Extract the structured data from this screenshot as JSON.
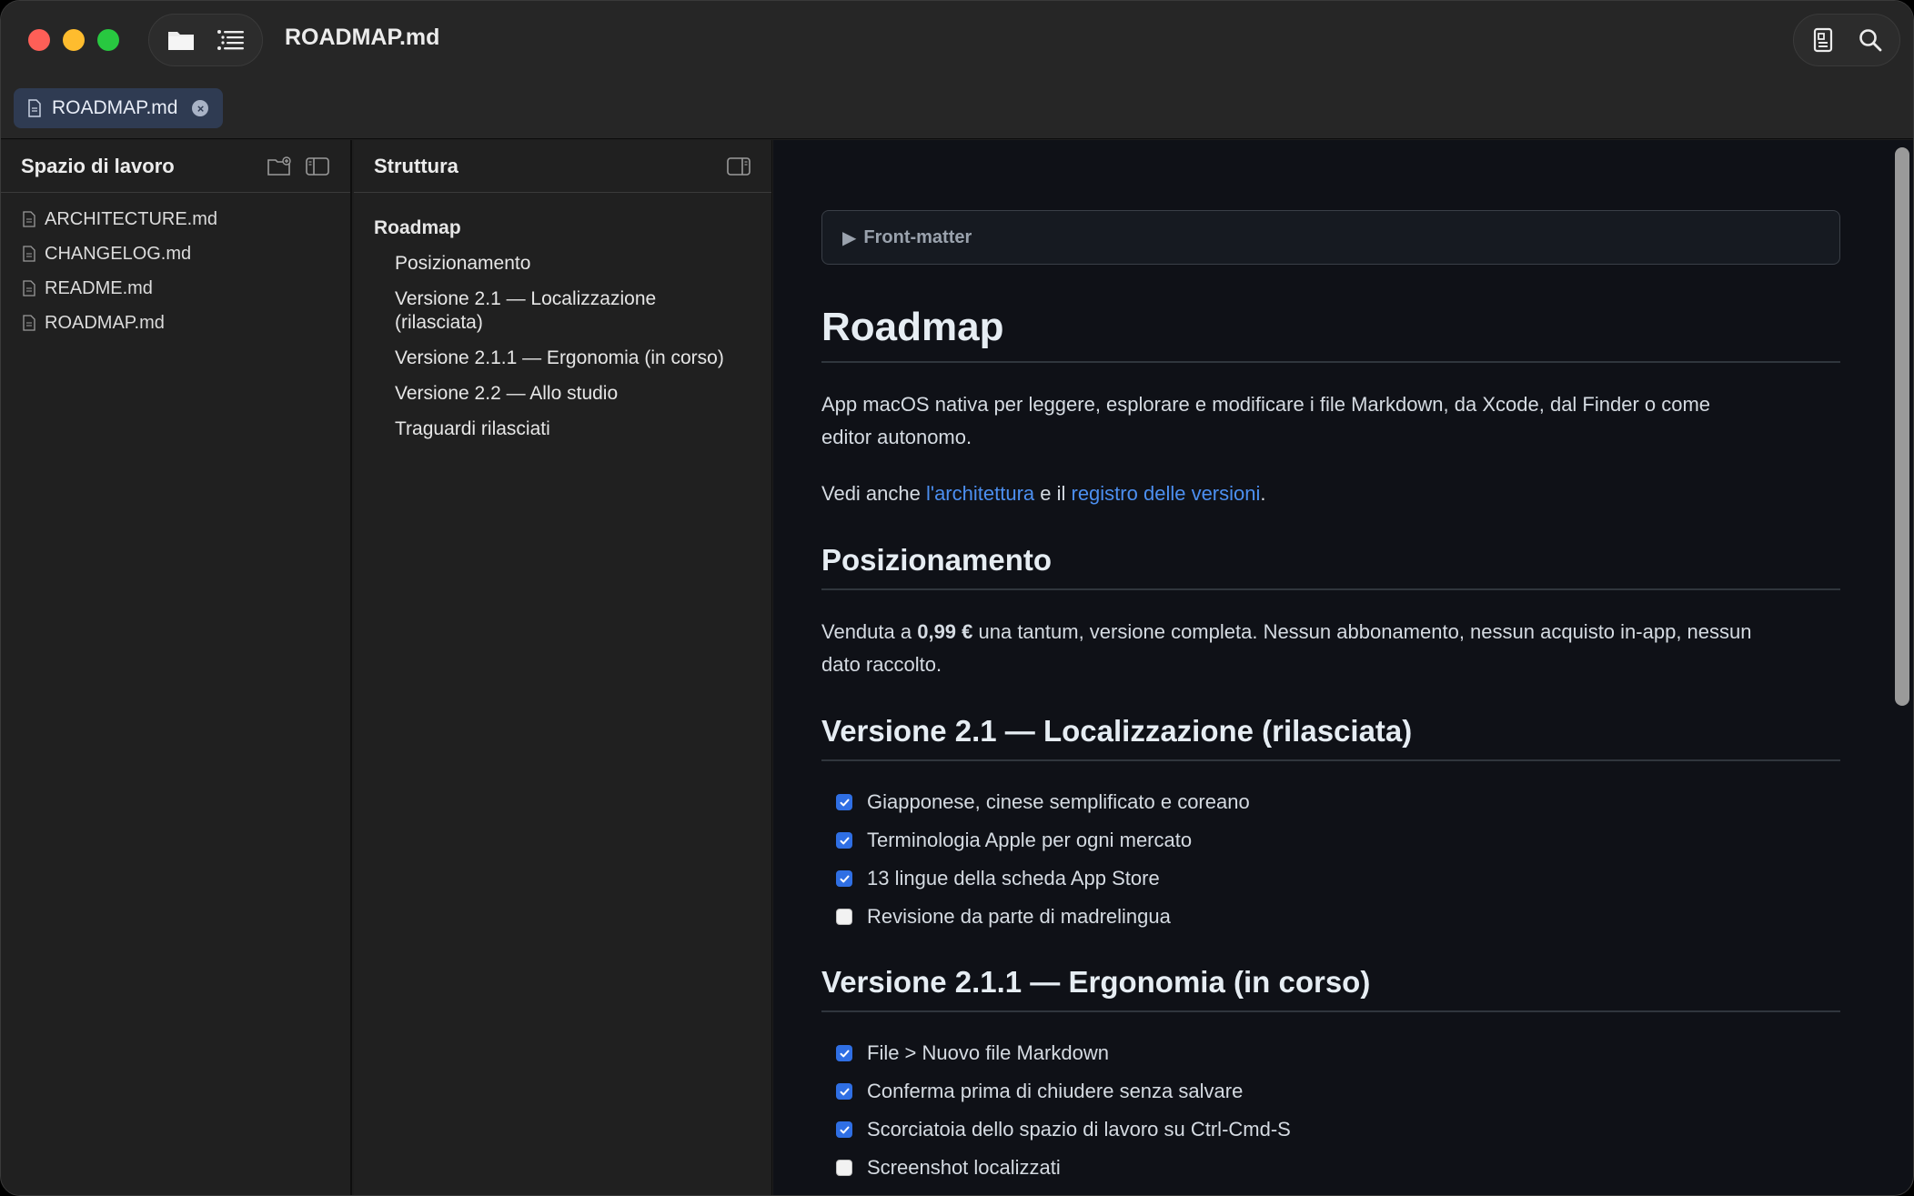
{
  "window": {
    "title": "ROADMAP.md"
  },
  "tabs": [
    {
      "label": "ROADMAP.md"
    }
  ],
  "sidebar": {
    "title": "Spazio di lavoro",
    "files": [
      {
        "name": "ARCHITECTURE.md"
      },
      {
        "name": "CHANGELOG.md"
      },
      {
        "name": "README.md"
      },
      {
        "name": "ROADMAP.md"
      }
    ]
  },
  "outline": {
    "title": "Struttura",
    "items": [
      {
        "label": "Roadmap"
      },
      {
        "label": "Posizionamento"
      },
      {
        "label": "Versione 2.1 — Localizzazione",
        "label2": "(rilasciata)"
      },
      {
        "label": "Versione 2.1.1 — Ergonomia (in corso)"
      },
      {
        "label": "Versione 2.2 — Allo studio"
      },
      {
        "label": "Traguardi rilasciati"
      }
    ]
  },
  "doc": {
    "frontmatter": "Front-matter",
    "h1": "Roadmap",
    "intro_line1": "App macOS nativa per leggere, esplorare e modificare i file Markdown, da Xcode, dal Finder o come",
    "intro_line2": "editor autonomo.",
    "see_also": {
      "prefix": "Vedi anche ",
      "link1": "l'architettura",
      "middle": " e il ",
      "link2": "registro delle versioni",
      "suffix": "."
    },
    "positioning": {
      "heading": "Posizionamento",
      "prefix": "Venduta a ",
      "price": "0,99 €",
      "line1_rest": " una tantum, versione completa. Nessun abbonamento, nessun acquisto in-app, nessun",
      "line2": "dato raccolto."
    },
    "v21": {
      "heading": "Versione 2.1 — Localizzazione (rilasciata)",
      "tasks": [
        {
          "label": "Giapponese, cinese semplificato e coreano",
          "done": true
        },
        {
          "label": "Terminologia Apple per ogni mercato",
          "done": true
        },
        {
          "label": "13 lingue della scheda App Store",
          "done": true
        },
        {
          "label": "Revisione da parte di madrelingua",
          "done": false
        }
      ]
    },
    "v211": {
      "heading": "Versione 2.1.1 — Ergonomia (in corso)",
      "tasks": [
        {
          "label": "File > Nuovo file Markdown",
          "done": true
        },
        {
          "label": "Conferma prima di chiudere senza salvare",
          "done": true
        },
        {
          "label": "Scorciatoia dello spazio di lavoro su Ctrl-Cmd-S",
          "done": true
        },
        {
          "label": "Screenshot localizzati",
          "done": false
        }
      ]
    }
  },
  "colors": {
    "accent": "#2f6fe4",
    "link": "#4c8ff0",
    "close": "#fe5f57",
    "minimize": "#febc2e",
    "zoom": "#28c840"
  }
}
